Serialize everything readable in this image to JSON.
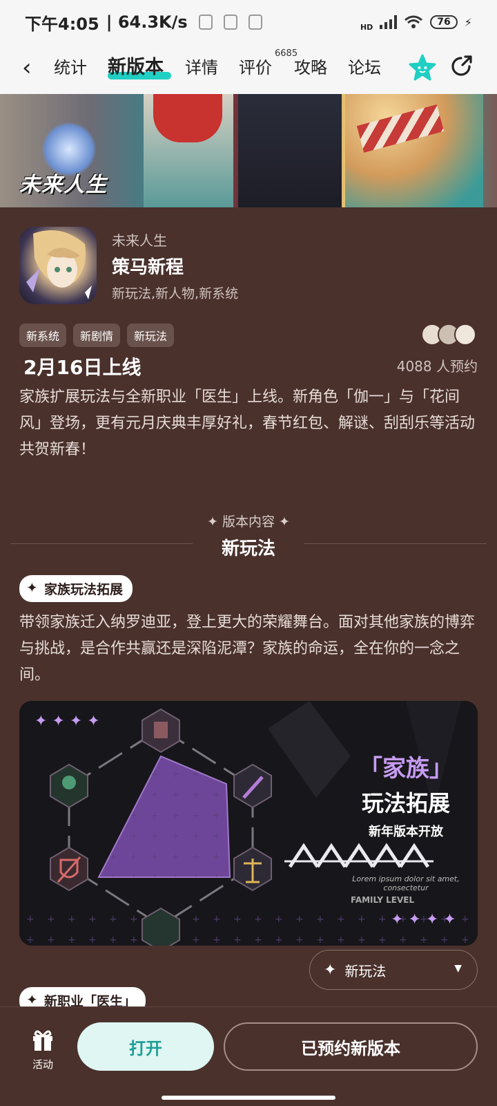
{
  "status": {
    "time": "下午4:05",
    "speed": "| 64.3K/s",
    "network": "HD",
    "battery": "76"
  },
  "nav": {
    "back_icon": "chevron-left-icon",
    "tabs": [
      {
        "label": "统计"
      },
      {
        "label": "新版本"
      },
      {
        "label": "详情"
      },
      {
        "label": "评价"
      },
      {
        "label": "攻略"
      },
      {
        "label": "论坛"
      }
    ],
    "review_count": "6685",
    "accent": "#1fcfc2"
  },
  "banner": {
    "logo": "未来人生"
  },
  "app": {
    "name": "未来人生",
    "version_title": "策马新程",
    "features": "新玩法,新人物,新系统",
    "tags": [
      "新系统",
      "新剧情",
      "新玩法"
    ],
    "launch_date": "2月16日上线",
    "reservations": "4088 人预约",
    "intro": "家族扩展玩法与全新职业「医生」上线。新角色「伽一」与「花间风」登场，更有元月庆典丰厚好礼，春节红包、解谜、刮刮乐等活动共贺新春！"
  },
  "section": {
    "small_title": "✦ 版本内容 ✦",
    "title": "新玩法"
  },
  "feature1": {
    "pill": "家族玩法拓展",
    "text": "带领家族迁入纳罗迪亚，登上更大的荣耀舞台。面对其他家族的博弈与挑战，是合作共赢还是深陷泥潭？家族的命运，全在你的一念之间。",
    "image": {
      "title_a": "「家族」",
      "title_b": "玩法拓展",
      "title_c": "新年版本开放",
      "caption": "FAMILY LEVEL",
      "lorem": "Lorem ipsum dolor sit amet, consectetur"
    }
  },
  "dropdown": {
    "value": "新玩法"
  },
  "feature2": {
    "pill": "新职业「医生」"
  },
  "bottom": {
    "gift_label": "活动",
    "open": "打开",
    "reserved": "已预约新版本"
  }
}
